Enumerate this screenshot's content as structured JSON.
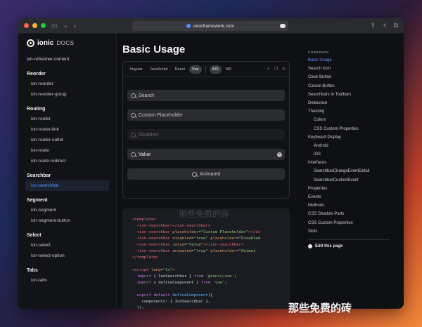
{
  "browser": {
    "url": "ionicframework.com",
    "colors": {
      "close": "#ff5f57",
      "minimize": "#febc2e",
      "maximize": "#28c840"
    }
  },
  "sidebar": {
    "logo_text": "ionic",
    "logo_sub": "DOCS",
    "top_link": "ion-refresher-content",
    "sections": [
      {
        "title": "Reorder",
        "items": [
          "ion-reorder",
          "ion-reorder-group"
        ]
      },
      {
        "title": "Routing",
        "items": [
          "ion-router",
          "ion-router-link",
          "ion-router-outlet",
          "ion-route",
          "ion-route-redirect"
        ]
      },
      {
        "title": "Searchbar",
        "items": [
          "ion-searchbar"
        ]
      },
      {
        "title": "Segment",
        "items": [
          "ion-segment",
          "ion-segment-button"
        ]
      },
      {
        "title": "Select",
        "items": [
          "ion-select",
          "ion-select-option"
        ]
      },
      {
        "title": "Tabs",
        "items": [
          "ion-tabs"
        ]
      }
    ],
    "active_item": "ion-searchbar"
  },
  "main": {
    "title": "Basic Usage",
    "framework_tabs": [
      "Angular",
      "JavaScript",
      "React",
      "Vue"
    ],
    "selected_framework": "Vue",
    "mode_tabs": [
      "iOS",
      "MD"
    ],
    "selected_mode": "iOS",
    "searchbars": [
      {
        "text": "Search",
        "state": "placeholder"
      },
      {
        "text": "Custom Placeholder",
        "state": "placeholder"
      },
      {
        "text": "Disabled",
        "state": "disabled"
      },
      {
        "text": "Value",
        "state": "value"
      },
      {
        "text": "Animated",
        "state": "animated"
      }
    ],
    "code_watermark": "那些免费的砖"
  },
  "toc": {
    "heading": "CONTENTS",
    "items": [
      {
        "label": "Basic Usage",
        "level": 0,
        "active": true
      },
      {
        "label": "Search Icon",
        "level": 0
      },
      {
        "label": "Clear Button",
        "level": 0
      },
      {
        "label": "Cancel Button",
        "level": 0
      },
      {
        "label": "Searchbars in Toolbars",
        "level": 0
      },
      {
        "label": "Debounce",
        "level": 0
      },
      {
        "label": "Theming",
        "level": 0
      },
      {
        "label": "Colors",
        "level": 1
      },
      {
        "label": "CSS Custom Properties",
        "level": 1
      },
      {
        "label": "Keyboard Display",
        "level": 0
      },
      {
        "label": "Android",
        "level": 1
      },
      {
        "label": "iOS",
        "level": 1
      },
      {
        "label": "Interfaces",
        "level": 0
      },
      {
        "label": "SearchbarChangeEventDetail",
        "level": 1
      },
      {
        "label": "SearchbarCustomEvent",
        "level": 1
      },
      {
        "label": "Properties",
        "level": 0
      },
      {
        "label": "Events",
        "level": 0
      },
      {
        "label": "Methods",
        "level": 0
      },
      {
        "label": "CSS Shadow Parts",
        "level": 0
      },
      {
        "label": "CSS Custom Properties",
        "level": 0
      },
      {
        "label": "Slots",
        "level": 0
      }
    ],
    "edit_label": "Edit this page"
  },
  "footer_watermark": "那些免费的砖"
}
